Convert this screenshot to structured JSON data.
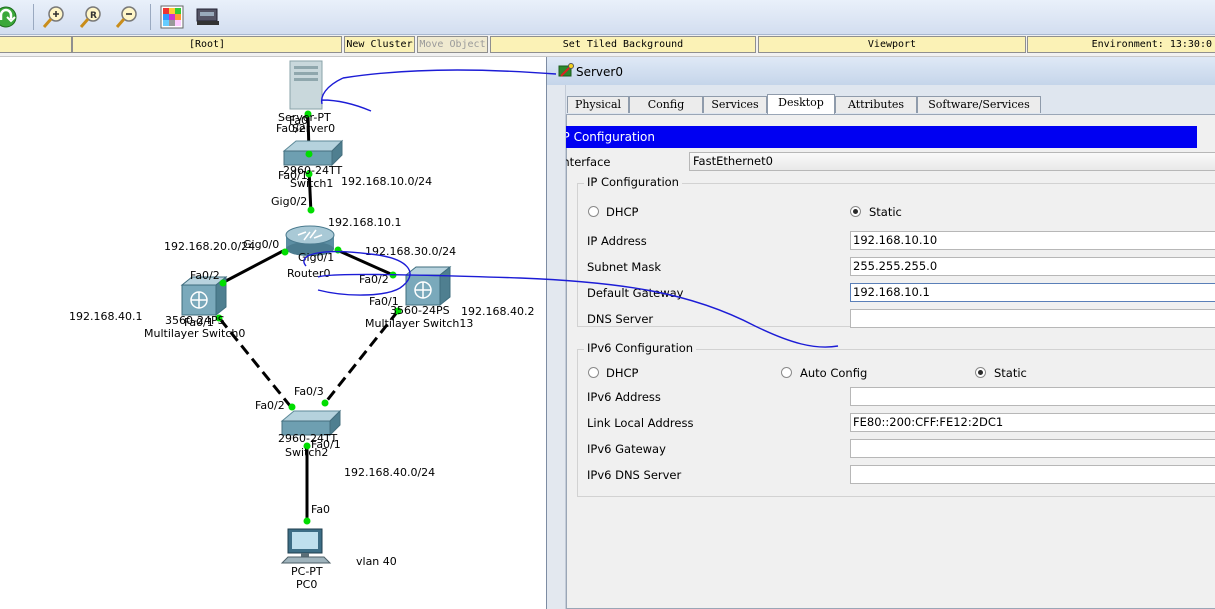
{
  "toolbar": {
    "icons": [
      "undo-icon",
      "zoom-in-icon",
      "zoom-reset-icon",
      "zoom-out-icon",
      "palette-icon",
      "custom-device-icon"
    ]
  },
  "logical_bar": {
    "root": "[Root]",
    "new_cluster": "New Cluster",
    "move_object": "Move Object",
    "set_tiled_background": "Set Tiled Background",
    "viewport": "Viewport",
    "environment": "Environment: 13:30:0"
  },
  "topology": {
    "server_model": "Server-PT",
    "server_name": "Server0",
    "server_port": "Fa0",
    "switch1_port_to_server": "Fa0/2",
    "switch1_model": "2960-24TT",
    "switch1_name": "Switch1",
    "switch1_port_to_router": "Fa0/1",
    "net_10": "192.168.10.0/24",
    "router_port_gig02": "Gig0/2",
    "router_ip": "192.168.10.1",
    "router_port_gig00": "Gig0/0",
    "router_port_gig01": "Gig0/1",
    "router_name": "Router0",
    "net_20": "192.168.20.0/24",
    "net_30": "192.168.30.0/24",
    "ms0_port_fa02": "Fa0/2",
    "ms0_model": "3560-24PS",
    "ms0_port_fa01": "Fa0/1",
    "ms0_name": "Multilayer Switch0",
    "ms0_ip": "192.168.40.1",
    "ms13_port_fa02": "Fa0/2",
    "ms13_port_fa01": "Fa0/1",
    "ms13_model": "3560-24PS",
    "ms13_name": "Multilayer Switch13",
    "ms13_ip": "192.168.40.2",
    "sw2_port_fa03": "Fa0/3",
    "sw2_port_fa02": "Fa0/2",
    "sw2_model": "2960-24TT",
    "sw2_port_fa01": "Fa0/1",
    "sw2_name": "Switch2",
    "net_40": "192.168.40.0/24",
    "pc_port": "Fa0",
    "pc_model": "PC-PT",
    "pc_name": "PC0",
    "vlan_note": "vlan 40"
  },
  "window": {
    "title": "Server0",
    "tabs": [
      "Physical",
      "Config",
      "Services",
      "Desktop",
      "Attributes",
      "Software/Services"
    ],
    "active_tab": "Desktop",
    "header": "IP Configuration",
    "interface_label": "Interface",
    "interface_value": "FastEthernet0",
    "ipv4": {
      "group_title": "IP Configuration",
      "dhcp_label": "DHCP",
      "static_label": "Static",
      "selected": "Static",
      "ip_label": "IP Address",
      "ip_value": "192.168.10.10",
      "mask_label": "Subnet Mask",
      "mask_value": "255.255.255.0",
      "gw_label": "Default Gateway",
      "gw_value": "192.168.10.1",
      "dns_label": "DNS Server",
      "dns_value": ""
    },
    "ipv6": {
      "group_title": "IPv6 Configuration",
      "dhcp_label": "DHCP",
      "auto_label": "Auto Config",
      "static_label": "Static",
      "selected": "Static",
      "addr_label": "IPv6 Address",
      "addr_value": "",
      "lla_label": "Link Local Address",
      "lla_value": "FE80::200:CFF:FE12:2DC1",
      "gw_label": "IPv6 Gateway",
      "gw_value": "",
      "dns_label": "IPv6 DNS Server",
      "dns_value": ""
    }
  },
  "colors": {
    "header_blue": "#0000f2",
    "link_green": "#00dd00",
    "annotation_blue": "#1c1cd6"
  }
}
